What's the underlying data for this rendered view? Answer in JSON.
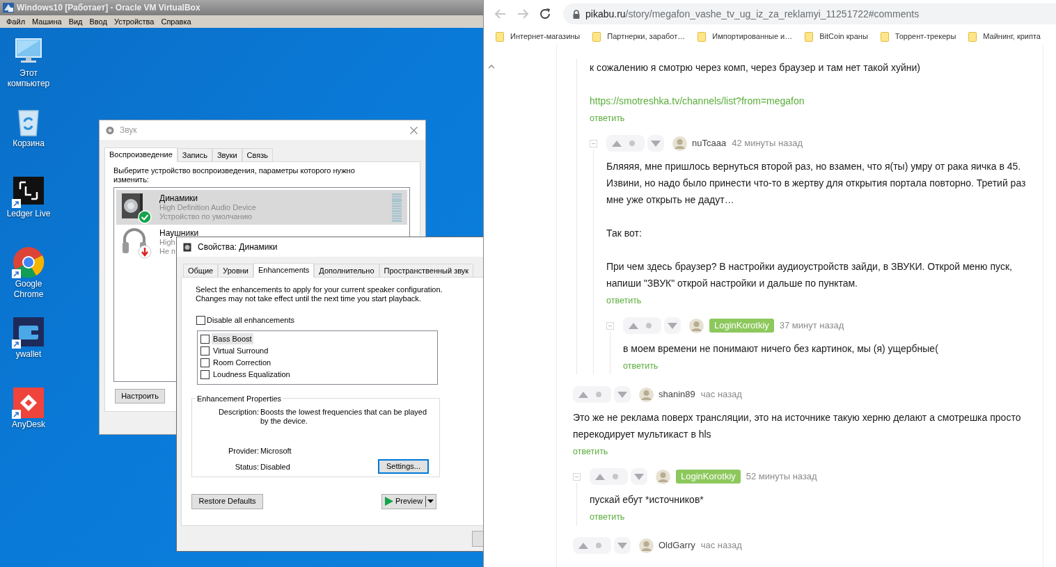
{
  "vm_window": {
    "title": "Windows10 [Работает] - Oracle VM VirtualBox",
    "menu": [
      "Файл",
      "Машина",
      "Вид",
      "Ввод",
      "Устройства",
      "Справка"
    ]
  },
  "desktop_icons": [
    {
      "kind": "computer",
      "label": "Этот компьютер",
      "shortcut": false
    },
    {
      "kind": "recycle",
      "label": "Корзина",
      "shortcut": false
    },
    {
      "kind": "ledger",
      "label": "Ledger Live",
      "shortcut": true
    },
    {
      "kind": "chrome",
      "label": "Google Chrome",
      "shortcut": true
    },
    {
      "kind": "wallet",
      "label": "ywallet",
      "shortcut": true
    },
    {
      "kind": "anydesk",
      "label": "AnyDesk",
      "shortcut": true
    }
  ],
  "sound_dialog": {
    "title": "Звук",
    "tabs": [
      {
        "label": "Воспроизведение",
        "selected": true
      },
      {
        "label": "Запись",
        "selected": false
      },
      {
        "label": "Звуки",
        "selected": false
      },
      {
        "label": "Связь",
        "selected": false
      }
    ],
    "prompt": "Выберите устройство воспроизведения, параметры которого нужно изменить:",
    "devices": [
      {
        "kind": "speakers",
        "is_default": true,
        "unplugged": false,
        "name": "Динамики",
        "lines": [
          "High Definition Audio Device",
          "Устройство по умолчанию"
        ],
        "selected": true
      },
      {
        "kind": "headphones",
        "is_default": false,
        "unplugged": true,
        "name": "Наушники",
        "lines": [
          "High",
          "Не п"
        ],
        "selected": false
      }
    ],
    "configure_button": "Настроить"
  },
  "properties_dialog": {
    "title": "Свойства: Динамики",
    "tabs": [
      {
        "label": "Общие",
        "selected": false
      },
      {
        "label": "Уровни",
        "selected": false
      },
      {
        "label": "Enhancements",
        "selected": true
      },
      {
        "label": "Дополнительно",
        "selected": false
      },
      {
        "label": "Пространственный звук",
        "selected": false
      }
    ],
    "intro": "Select the enhancements to apply for your current speaker configuration. Changes may not take effect until the next time you start playback.",
    "disable_all": {
      "label": "Disable all enhancements",
      "checked": false
    },
    "enhancements": [
      {
        "label": "Bass Boost",
        "checked": false,
        "selected": true
      },
      {
        "label": "Virtual Surround",
        "checked": false,
        "selected": false
      },
      {
        "label": "Room Correction",
        "checked": false,
        "selected": false
      },
      {
        "label": "Loudness Equalization",
        "checked": false,
        "selected": false
      }
    ],
    "group_title": "Enhancement Properties",
    "properties": [
      {
        "label": "Description:",
        "value": "Boosts the lowest frequencies that can be played by the device."
      },
      {
        "label": "Provider:",
        "value": "Microsoft"
      },
      {
        "label": "Status:",
        "value": "Disabled"
      }
    ],
    "settings_button": "Settings...",
    "restore_button": "Restore Defaults",
    "preview_button": "Preview"
  },
  "browser": {
    "back_disabled": true,
    "forward_disabled": true,
    "url_host": "pikabu.ru",
    "url_path": "/story/megafon_vashe_tv_ug_iz_za_reklamyi_11251722#comments",
    "bookmarks": [
      "Интернет-магазины",
      "Партнерки, заработ…",
      "Импортированные и…",
      "BitCoin краны",
      "Торрент-трекеры",
      "Майнинг, крипта"
    ],
    "comments": [
      {
        "children": [
          {
            "blocks": [
              {
                "kind": "text",
                "text": "к сожалению я смотрю через комп, через браузер и там нет такой хуйни)"
              },
              {
                "kind": "link",
                "text": "https://smotreshka.tv/channels/list?from=megafon"
              }
            ],
            "reply": "ответить",
            "children": [
              {
                "author": "nuTcaaa",
                "highlighted": false,
                "time": "42 минуты назад",
                "blocks": [
                  {
                    "kind": "text",
                    "text": "Бляяяя, мне пришлось вернуться второй раз, но взамен, что я(ты) умру от рака яичка в 45. Извини, но надо было принести что-то в жертву для открытия портала повторно. Третий раз мне уже открыть не дадут…"
                  },
                  {
                    "kind": "text",
                    "text": "Так вот:"
                  },
                  {
                    "kind": "text",
                    "text": "При чем здесь браузер? В настройки аудиоустройств зайди, в ЗВУКИ. Открой меню пуск, напиши \"ЗВУК\" открой настройки и дальше по пунктам."
                  }
                ],
                "reply": "ответить",
                "children": [
                  {
                    "author": "LoginKorotkiy",
                    "highlighted": true,
                    "time": "37 минут назад",
                    "blocks": [
                      {
                        "kind": "text",
                        "text": "в моем времени не понимают ничего без картинок, мы (я) ущербные("
                      }
                    ],
                    "reply": "ответить"
                  }
                ]
              }
            ]
          }
        ]
      },
      {
        "author": "shanin89",
        "highlighted": false,
        "time": "час назад",
        "blocks": [
          {
            "kind": "text",
            "text": "Это же не реклама поверх трансляции, это на источнике такую херню делают а смотрешка просто перекодирует мультикаст в hls"
          }
        ],
        "reply": "ответить",
        "children": [
          {
            "author": "LoginKorotkiy",
            "highlighted": true,
            "time": "52 минуты назад",
            "blocks": [
              {
                "kind": "text",
                "text": "пускай ебут *источников*"
              }
            ],
            "reply": "ответить"
          }
        ]
      },
      {
        "author": "OldGarry",
        "highlighted": false,
        "time": "час назад"
      }
    ]
  }
}
